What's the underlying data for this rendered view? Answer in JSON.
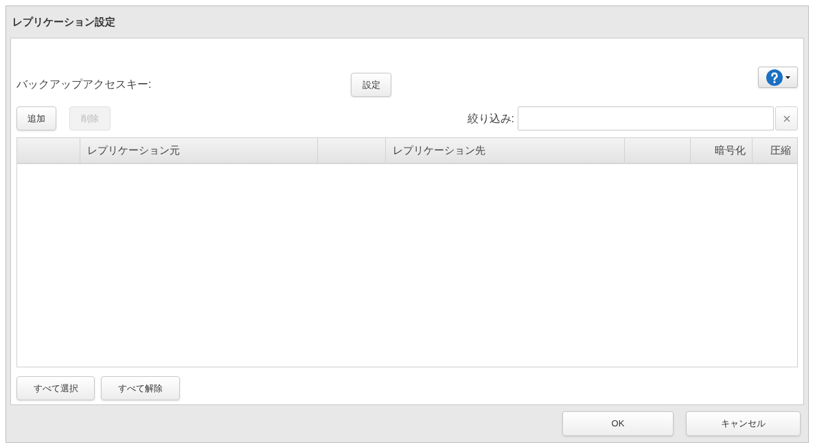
{
  "window": {
    "title": "レプリケーション設定"
  },
  "access_key": {
    "label": "バックアップアクセスキー:",
    "button": "設定"
  },
  "toolbar": {
    "buttons": [
      {
        "label": "追加",
        "disabled": false
      },
      {
        "label": "削除",
        "disabled": true
      }
    ],
    "filter": {
      "label": "絞り込み:"
    }
  },
  "table": {
    "columns": [
      {
        "kind": "blank"
      },
      {
        "kind": "text",
        "label": "レプリケーション元"
      },
      {
        "kind": "blank"
      },
      {
        "kind": "text",
        "label": "レプリケーション先"
      },
      {
        "kind": "blank"
      },
      {
        "kind": "text",
        "label": "暗号化"
      },
      {
        "kind": "text",
        "label": "圧縮"
      }
    ]
  },
  "selection_buttons": [
    "すべて選択",
    "すべて解除"
  ],
  "footer_buttons": [
    "OK",
    "キャンセル"
  ]
}
